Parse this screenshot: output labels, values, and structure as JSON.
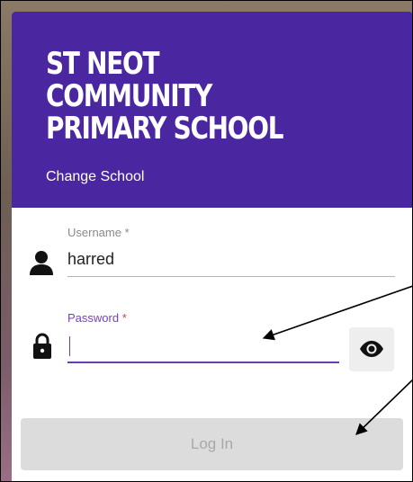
{
  "header": {
    "school_name": "ST NEOT\nCOMMUNITY\nPRIMARY SCHOOL",
    "change_school_label": "Change School",
    "background_color": "#4a27a0"
  },
  "username": {
    "label": "Username",
    "required_marker": "*",
    "value": "harred",
    "icon": "person-icon"
  },
  "password": {
    "label": "Password",
    "required_marker": "*",
    "value": "",
    "icon": "lock-icon",
    "toggle_icon": "eye-icon",
    "accent_color": "#6a3ab7"
  },
  "login_button": {
    "label": "Log In",
    "state": "disabled"
  }
}
